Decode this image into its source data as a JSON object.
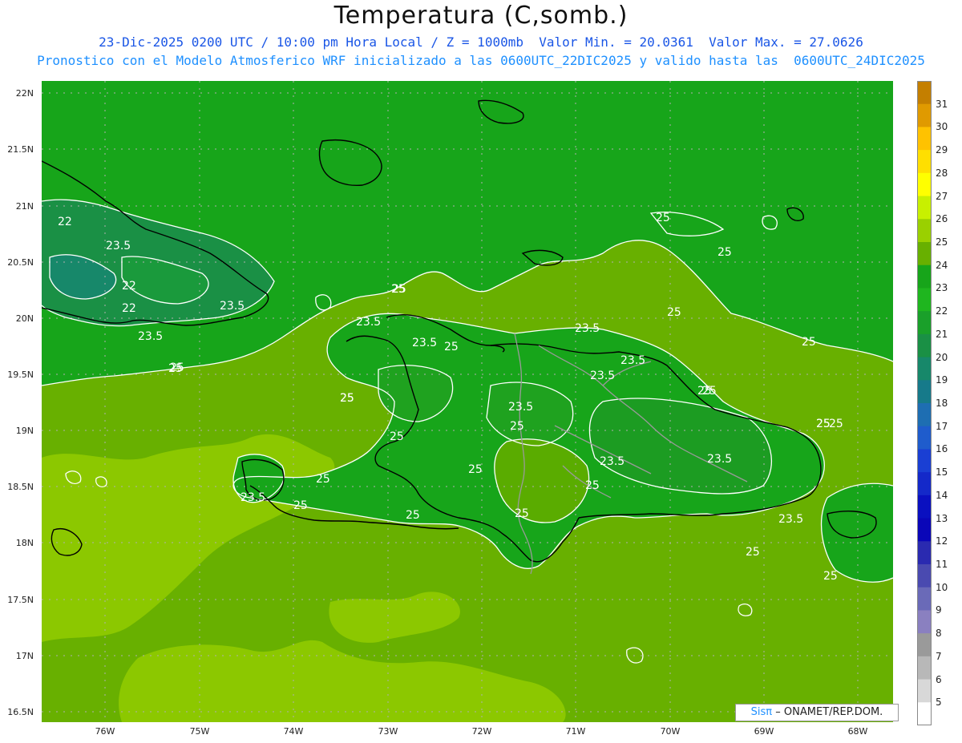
{
  "header": {
    "title": "Temperatura (C,somb.)",
    "line1": "23-Dic-2025 0200 UTC / 10:00 pm Hora Local / Z = 1000mb  Valor Min. = 20.0361  Valor Max. = 27.0626",
    "line2": "Pronostico con el Modelo Atmosferico WRF inicializado a las 0600UTC_22DIC2025 y valido hasta las  0600UTC_24DIC2025"
  },
  "axes": {
    "lat_labels": [
      "22N",
      "21.5N",
      "21N",
      "20.5N",
      "20N",
      "19.5N",
      "19N",
      "18.5N",
      "18N",
      "17.5N",
      "17N",
      "16.5N"
    ],
    "lon_labels": [
      "76W",
      "75W",
      "74W",
      "73W",
      "72W",
      "71W",
      "70W",
      "69W",
      "68W"
    ]
  },
  "colorbar": {
    "labels": [
      "31",
      "30",
      "29",
      "28",
      "27",
      "26",
      "25",
      "24",
      "23",
      "22",
      "21",
      "20",
      "19",
      "18",
      "17",
      "16",
      "15",
      "14",
      "13",
      "12",
      "11",
      "10",
      "9",
      "8",
      "7",
      "6",
      "5"
    ],
    "colors": [
      "#c47f00",
      "#e09a00",
      "#ffc200",
      "#ffdf00",
      "#ffff00",
      "#c8f000",
      "#9ad000",
      "#68b000",
      "#17a51a",
      "#1fb61f",
      "#1aa02a",
      "#1a9045",
      "#17886a",
      "#167a8a",
      "#1e6eb2",
      "#1f5ccc",
      "#1a3fd3",
      "#1429c9",
      "#0a10c0",
      "#0a06b8",
      "#2a2ab0",
      "#4a4ab0",
      "#6a6ab8",
      "#8a80c0",
      "#9a9a9a",
      "#b8b8b8",
      "#d8d8d8",
      "#ffffff"
    ]
  },
  "contours": {
    "labels": [
      "22",
      "23.5",
      "22",
      "22",
      "23.5",
      "23.5",
      "25",
      "25",
      "23.5",
      "23.5",
      "25",
      "25",
      "25",
      "25",
      "23.5",
      "23.5",
      "23.5",
      "25",
      "25",
      "25",
      "25",
      "25",
      "23.5",
      "25",
      "25",
      "25",
      "23.5",
      "25",
      "23.5",
      "25",
      "25",
      "25",
      "25",
      "25",
      "25",
      "23.5",
      "25",
      "23.5",
      "25",
      "25",
      "25",
      "25"
    ]
  },
  "credit": {
    "sis": "Sisπ",
    "text": "– ONAMET/REP.DOM."
  },
  "colors": {
    "field_24": "#17a51a",
    "field_25": "#68b000",
    "field_26": "#9ad000",
    "field_22": "#1a9045",
    "field_21": "#17886a",
    "coast": "#000000",
    "border": "#9a9a9a",
    "contour": "#ffffff"
  }
}
